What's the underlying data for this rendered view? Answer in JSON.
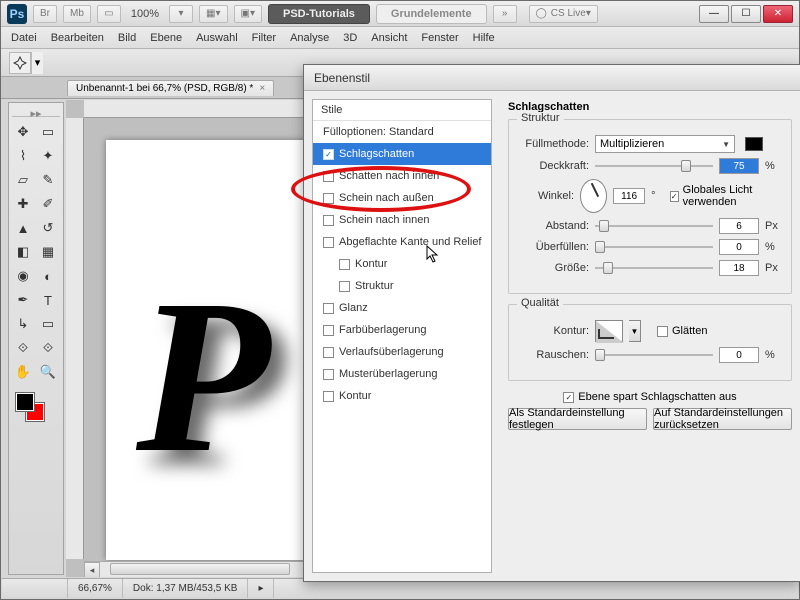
{
  "app": {
    "icon_text": "Ps",
    "zoom": "100%",
    "cslive": "CS Live"
  },
  "title_tabs": {
    "tut": "PSD-Tutorials",
    "grund": "Grundelemente"
  },
  "menu": [
    "Datei",
    "Bearbeiten",
    "Bild",
    "Ebene",
    "Auswahl",
    "Filter",
    "Analyse",
    "3D",
    "Ansicht",
    "Fenster",
    "Hilfe"
  ],
  "doc_tab": "Unbenannt-1 bei 66,7% (PSD, RGB/8) *",
  "swatches": {
    "fg": "#000000",
    "bg": "#ff0000"
  },
  "status": {
    "zoom": "66,67%",
    "docinfo": "Dok: 1,37 MB/453,5 KB"
  },
  "canvas": {
    "text": "P"
  },
  "dialog": {
    "title": "Ebenenstil",
    "styles_header": "Stile",
    "items": [
      {
        "label": "Fülloptionen: Standard",
        "checked": null
      },
      {
        "label": "Schlagschatten",
        "checked": true,
        "selected": true
      },
      {
        "label": "Schatten nach innen",
        "checked": false
      },
      {
        "label": "Schein nach außen",
        "checked": false
      },
      {
        "label": "Schein nach innen",
        "checked": false
      },
      {
        "label": "Abgeflachte Kante und Relief",
        "checked": false
      },
      {
        "label": "Kontur",
        "checked": false,
        "indent": true
      },
      {
        "label": "Struktur",
        "checked": false,
        "indent": true
      },
      {
        "label": "Glanz",
        "checked": false
      },
      {
        "label": "Farbüberlagerung",
        "checked": false
      },
      {
        "label": "Verlaufsüberlagerung",
        "checked": false
      },
      {
        "label": "Musterüberlagerung",
        "checked": false
      },
      {
        "label": "Kontur",
        "checked": false
      }
    ],
    "ds": {
      "section": "Schlagschatten",
      "struktur": "Struktur",
      "fullmethode_label": "Füllmethode:",
      "fullmethode_value": "Multiplizieren",
      "deckkraft_label": "Deckkraft:",
      "deckkraft_value": "75",
      "winkel_label": "Winkel:",
      "winkel_value": "116",
      "globales": "Globales Licht verwenden",
      "abstand_label": "Abstand:",
      "abstand_value": "6",
      "uberfullen_label": "Überfüllen:",
      "uberfullen_value": "0",
      "grosse_label": "Größe:",
      "grosse_value": "18",
      "qualitat": "Qualität",
      "kontur_label": "Kontur:",
      "glatten": "Glätten",
      "rauschen_label": "Rauschen:",
      "rauschen_value": "0",
      "layer_knockout": "Ebene spart Schlagschatten aus",
      "btn_default": "Als Standardeinstellung festlegen",
      "btn_reset": "Auf Standardeinstellungen zurücksetzen",
      "px": "Px",
      "pct": "%",
      "deg": "°"
    }
  }
}
